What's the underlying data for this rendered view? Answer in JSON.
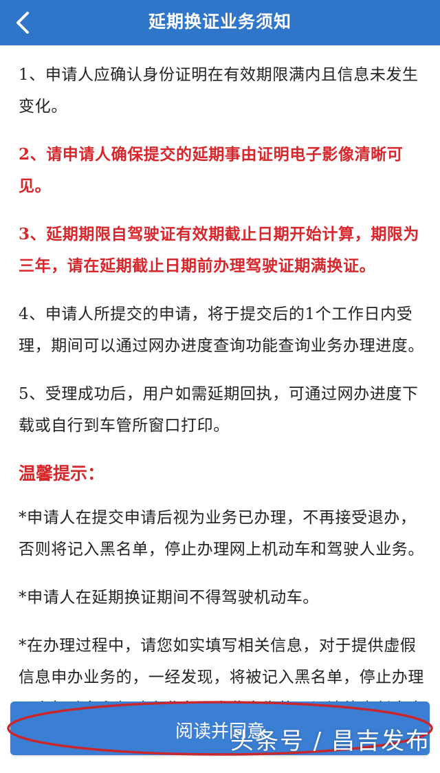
{
  "header": {
    "title": "延期换证业务须知"
  },
  "notice": [
    {
      "text": "1、申请人应确认身份证明在有效期限满内且信息未发生变化。",
      "highlight": false
    },
    {
      "text": "2、请申请人确保提交的延期事由证明电子影像清晰可见。",
      "highlight": true
    },
    {
      "text": "3、延期期限自驾驶证有效期截止日期开始计算，期限为三年，请在延期截止日期前办理驾驶证期满换证。",
      "highlight": true
    },
    {
      "text": "4、申请人所提交的申请，将于提交后的1个工作日内受理，期间可以通过网办进度查询功能查询业务办理进度。",
      "highlight": false
    },
    {
      "text": "5、受理成功后，用户如需延期回执，可通过网办进度下载或自行到车管所窗口打印。",
      "highlight": false
    }
  ],
  "tips": {
    "title": "温馨提示：",
    "items": [
      "*申请人在提交申请后视为业务已办理，不再接受退办，否则将记入黑名单，停止办理网上机动车和驾驶人业务。",
      "*申请人在延期换证期间不得驾驶机动车。",
      "*在办理过程中，请您如实填写相关信息，对于提供虚假信息申办业务的，一经发现，将被记入黑名单，停止办理网上机动车和驾驶人业务。由此产生的一切法律责任由申请人承担。"
    ]
  },
  "agree_button": {
    "label": "阅读并同意"
  },
  "watermark": "头条号 / 昌吉发布",
  "colors": {
    "header_bg": "#2f75c9",
    "highlight_text": "#d8262b",
    "button_bg": "#3b7fd4",
    "annotation_circle": "#c8282d"
  },
  "icons": {
    "back": "chevron-left-icon"
  }
}
